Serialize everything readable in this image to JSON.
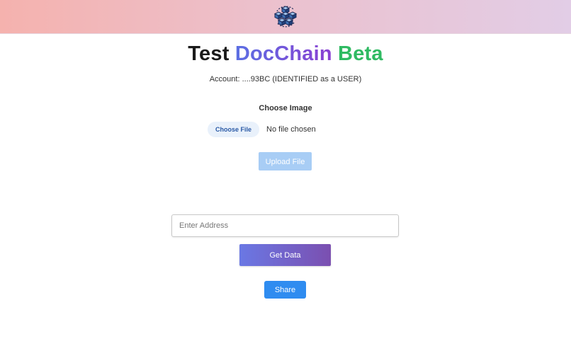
{
  "header": {
    "logo_icon": "blockchain-cubes-icon"
  },
  "title": {
    "part1": "Test",
    "part2": "DocChain",
    "part3": "Beta"
  },
  "account": {
    "text": "Account: ....93BC (IDENTIFIED as a USER)"
  },
  "upload": {
    "label": "Choose Image",
    "choose_file_label": "Choose File",
    "file_status": "No file chosen",
    "upload_label": "Upload File"
  },
  "query": {
    "address_placeholder": "Enter Address",
    "address_value": "",
    "get_data_label": "Get Data",
    "share_label": "Share"
  },
  "colors": {
    "accent_blue": "#2f8cf0",
    "upload_disabled": "#a8cdf5",
    "beta_green": "#2fba62",
    "gradient_start": "#6a78e4",
    "gradient_end": "#7b4fb0"
  }
}
